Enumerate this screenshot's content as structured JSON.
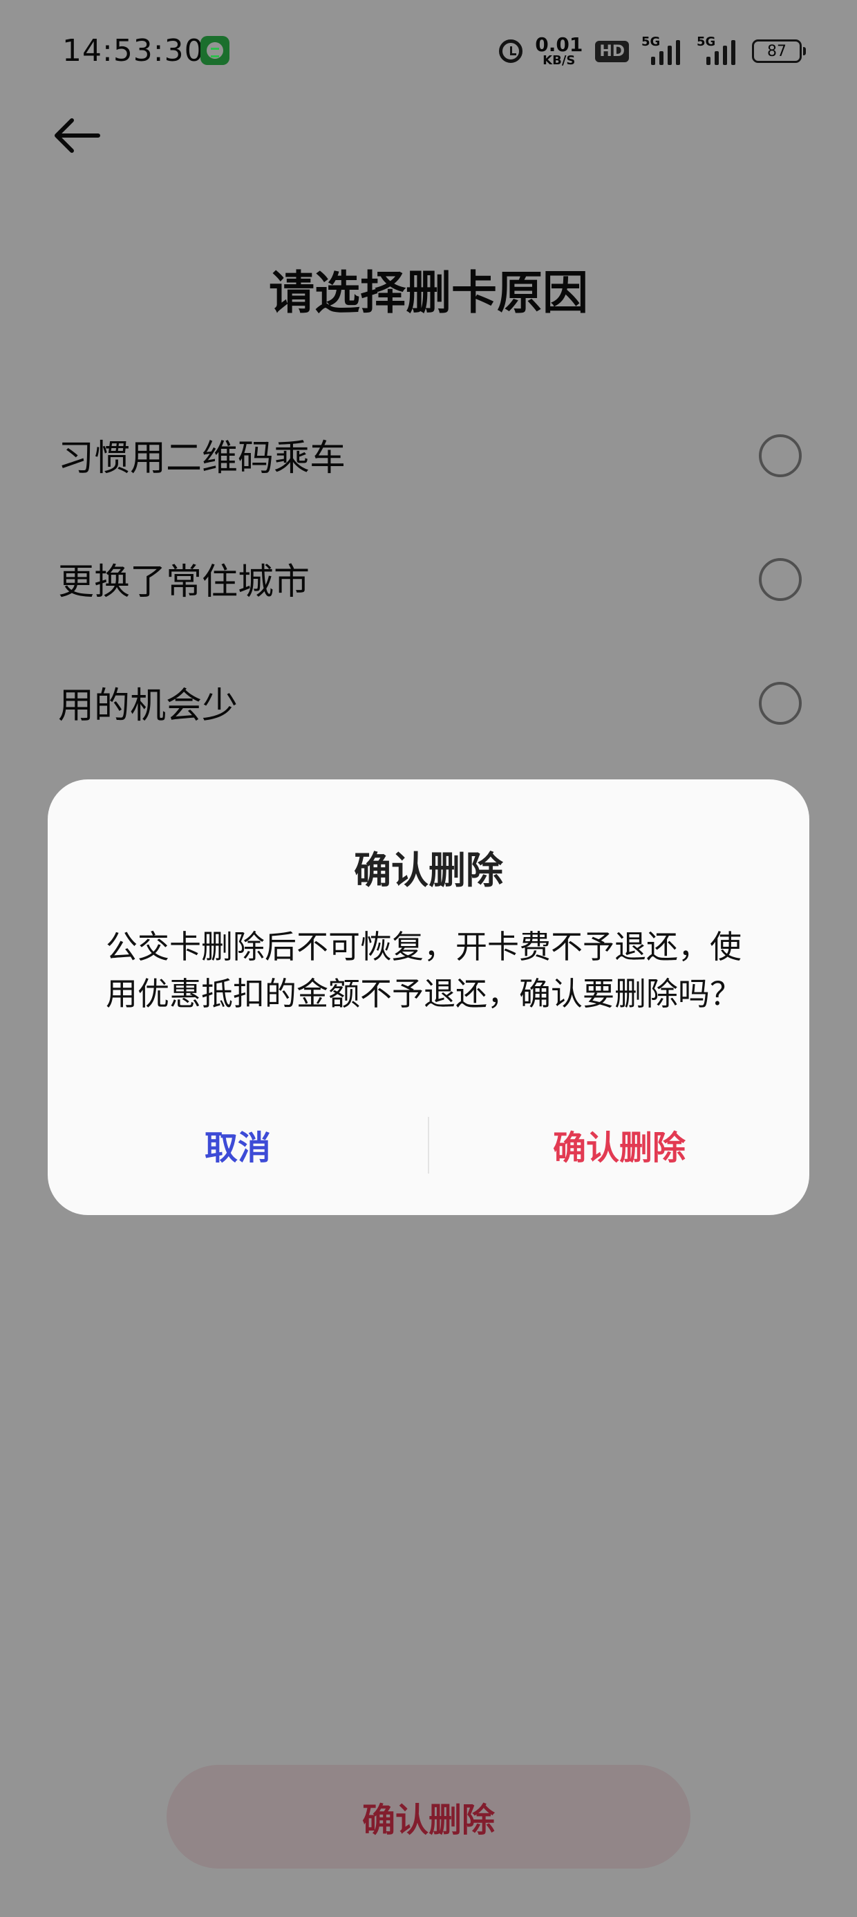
{
  "status_bar": {
    "time": "14:53:30",
    "net_speed_value": "0.01",
    "net_speed_unit": "KB/S",
    "hd_label": "HD",
    "signal1_label": "5G",
    "signal2_label": "5G",
    "battery_level": "87",
    "icons": [
      "app-notification-icon",
      "alarm-icon",
      "signal-icon",
      "battery-icon"
    ]
  },
  "header": {
    "back_icon": "back-arrow-icon"
  },
  "page": {
    "title": "请选择删卡原因",
    "reasons": [
      {
        "label": "习惯用二维码乘车",
        "selected": false
      },
      {
        "label": "更换了常住城市",
        "selected": false
      },
      {
        "label": "用的机会少",
        "selected": false
      }
    ],
    "bottom_button_label": "确认删除"
  },
  "dialog": {
    "title": "确认删除",
    "message": "公交卡删除后不可恢复，开卡费不予退还，使用优惠抵扣的金额不予退还，确认要删除吗？",
    "cancel_label": "取消",
    "confirm_label": "确认删除"
  },
  "colors": {
    "accent_blue": "#3d4bd6",
    "danger_red": "#e23a52",
    "scrim": "rgba(0,0,0,0.42)"
  }
}
